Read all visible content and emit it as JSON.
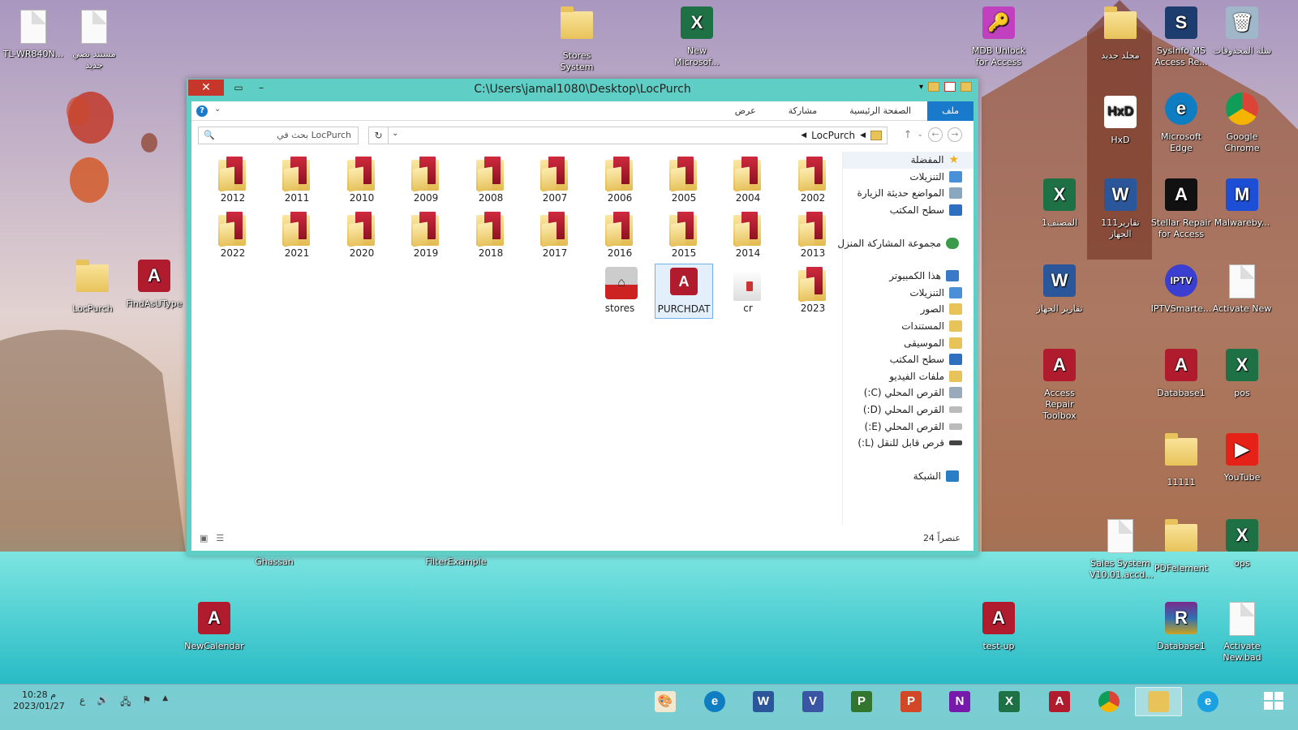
{
  "window": {
    "title": "C:\\Users\\jamal1080\\Desktop\\LocPurch",
    "close": "✕",
    "maximize": "▭",
    "minimize": "–"
  },
  "ribbon": {
    "tabs": [
      "ملف",
      "الصفحة الرئيسية",
      "مشاركة",
      "عرض"
    ],
    "active_tab": "ملف",
    "help": "?"
  },
  "search": {
    "placeholder": "بحث في LocPurch"
  },
  "address": {
    "current": "LocPurch"
  },
  "navpane": {
    "favorites_label": "المفضلة",
    "favorites": [
      "التنزيلات",
      "المواضع حديثة الزيارة",
      "سطح المكتب"
    ],
    "homegroup": "مجموعة المشاركة المنزل",
    "computer_label": "هذا الكمبيوتر",
    "computer": [
      "التنزيلات",
      "الصور",
      "المستندات",
      "الموسيقى",
      "سطح المكتب",
      "ملفات الفيديو",
      "القرص المحلي (C:)",
      "القرص المحلي (D:)",
      "القرص المحلي (E:)",
      "قرص قابل للنقل (L:)"
    ],
    "network": "الشبكة"
  },
  "files": {
    "row1": [
      "2002",
      "2004",
      "2005",
      "2006",
      "2007",
      "2008",
      "2009",
      "2010",
      "2011",
      "2012"
    ],
    "row2": [
      "2013",
      "2014",
      "2015",
      "2016",
      "2017",
      "2018",
      "2019",
      "2020",
      "2021",
      "2022"
    ],
    "row3": [
      "2023",
      "cr",
      "PURCHDAT",
      "stores"
    ],
    "selected": "PURCHDAT"
  },
  "status": {
    "count": "24 عنصراً"
  },
  "desktop": {
    "left": [
      "TL-WR840N...",
      "مستند نصي جديد",
      "LocPurch",
      "FindAsUType",
      "NewCalendar"
    ],
    "top": [
      "Stores System",
      "New Microsof..."
    ],
    "bottom_mid": [
      "Ghassan",
      "FilterExample"
    ],
    "right": [
      "MDB Unlock for Access",
      "مجلد جديد",
      "SysInfo MS Access Re...",
      "سلة المحذوفات",
      "HxD",
      "Microsoft Edge",
      "Google Chrome",
      "المصنف1",
      "تقارير111 الجهاز",
      "Stellar Repair for Access",
      "Malwareby...",
      "تقارير الجهاز",
      "IPTVSmarte...",
      "Activate New",
      "Access Repair Toolbox",
      "Database1",
      "pos",
      "11111",
      "YouTube",
      "Sales System V10.01.accd...",
      "PDFelement",
      "ops",
      "test-up",
      "Database1",
      "Activate New.bad"
    ]
  },
  "taskbar": {
    "time": "10:28 م",
    "date": "2023/01/27",
    "lang": "ع",
    "apps": [
      "Paint",
      "Edge",
      "W",
      "V",
      "P",
      "P",
      "N",
      "X",
      "A",
      "Chrome",
      "Explorer",
      "IE"
    ]
  },
  "colors": {
    "accent": "#5fcfc6",
    "selected_tab": "#1979ca",
    "close": "#c7362b"
  }
}
